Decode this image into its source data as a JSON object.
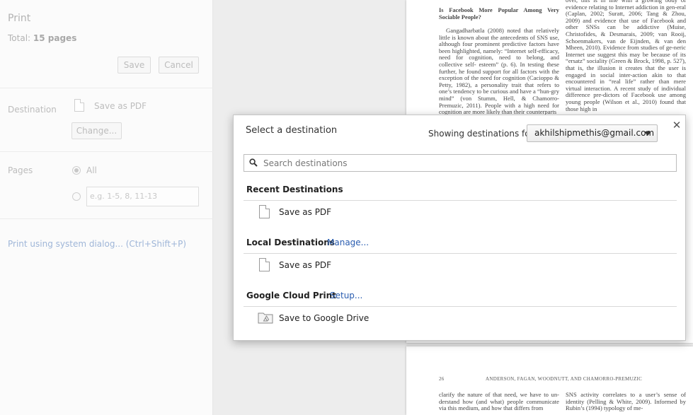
{
  "sidebar": {
    "title": "Print",
    "total_label": "Total:",
    "total_value": "15 pages",
    "save_label": "Save",
    "cancel_label": "Cancel",
    "destination_label": "Destination",
    "destination_value": "Save as PDF",
    "change_label": "Change...",
    "pages_label": "Pages",
    "pages_all_label": "All",
    "pages_custom_placeholder": "e.g. 1-5, 8, 11-13",
    "system_dialog_link": "Print using system dialog... (Ctrl+Shift+P)"
  },
  "preview": {
    "page1": {
      "heading": "Is Facebook More Popular Among Very Sociable People?",
      "left_text": "Gangadharbatla (2008) noted that relatively little is known about the antecedents of SNS use, although four prominent predictive factors have been highlighted, namely: “Internet self-efficacy, need for cognition, need to belong, and collective self- esteem” (p. 6). In testing these further, he found support for all factors with the exception of the need for cognition (Cacioppo & Petty, 1982), a personality trait that refers to one’s tendency to be curious and have a “hun-gry mind” (von Stumm, Hell, & Chamorro-Premuzic, 2011). People with a high need for cognition are more likely than their counterparts",
      "right_text": "over, this is in line with a growing body of evidence relating to Internet addiction in gen-eral (Caplan, 2002; Suratt, 2006; Tang & Zhou, 2009) and evidence that use of Facebook and other SNSs can be addictive (Muise, Christofides, & Desmarais, 2009; van Rooij, Schoenmakers, van de Eijnden, & van den Mheen, 2010). Evidence from studies of ge-neric Internet use suggest this may be because of its “ersatz” sociality (Green & Brock, 1998, p. 527), that is, the illusion it creates that the user is engaged in social inter-action akin to that encountered in “real life” rather than mere virtual interaction. A recent study of individual difference pre-dictors of Facebook use among young people (Wilson et al., 2010) found that those high in"
    },
    "page2": {
      "page_number": "26",
      "running_head": "ANDERSON, FAGAN, WOODNUTT, AND CHAMORRO-PREMUZIC",
      "left_text": "clarify the nature of that need, we have to un-derstand how (and what) people communicate via this medium, and how that differs from",
      "right_text": "SNS activity correlates to a user’s sense of identity (Pelling & White, 2009). Informed by Rubin’s (1994) typology of me-"
    }
  },
  "dialog": {
    "title": "Select a destination",
    "showing_label": "Showing destinations for",
    "account": "akhilshipmethis@gmail.com",
    "search_placeholder": "Search destinations",
    "recent_heading": "Recent Destinations",
    "recent_items": [
      "Save as PDF"
    ],
    "local_heading": "Local Destinations",
    "local_manage": "Manage...",
    "local_items": [
      "Save as PDF"
    ],
    "cloud_heading": "Google Cloud Print",
    "cloud_setup": "Setup...",
    "cloud_items": [
      "Save to Google Drive"
    ]
  },
  "colors": {
    "link": "#2a5db0",
    "sidebar_text_dimmed": "#bdbdbd"
  }
}
